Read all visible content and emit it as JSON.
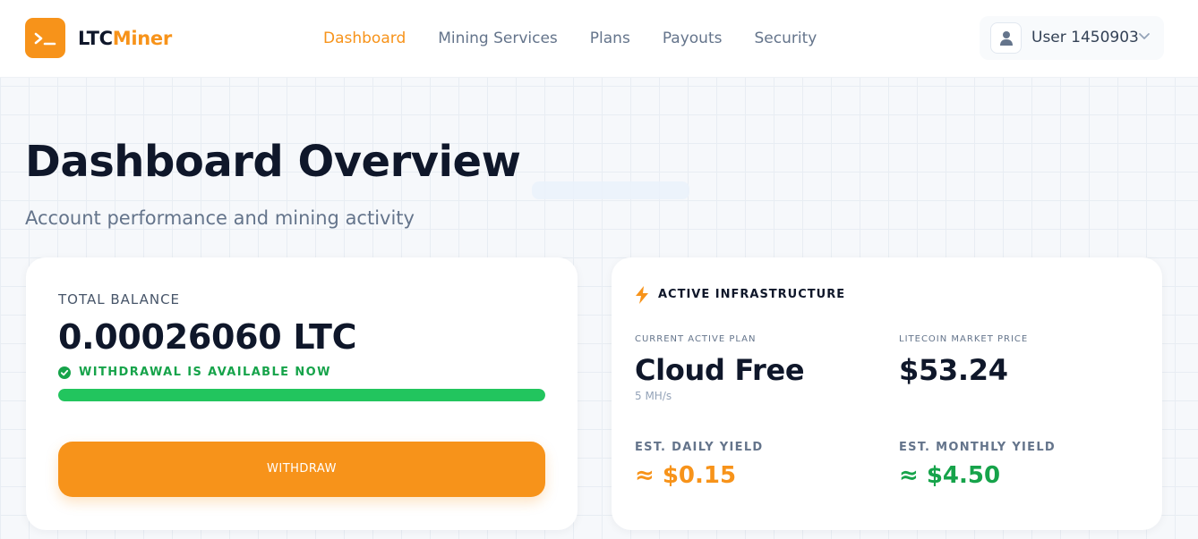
{
  "header": {
    "brand_part1": "LTC",
    "brand_part2": "Miner",
    "logo_icon": "terminal-prompt-icon",
    "nav": [
      {
        "label": "Dashboard",
        "active": true
      },
      {
        "label": "Mining Services",
        "active": false
      },
      {
        "label": "Plans",
        "active": false
      },
      {
        "label": "Payouts",
        "active": false
      },
      {
        "label": "Security",
        "active": false
      }
    ],
    "user": {
      "name": "User 1450903",
      "avatar_icon": "user-icon",
      "menu_icon": "chevron-down-icon"
    }
  },
  "page": {
    "title": "Dashboard Overview",
    "subtitle": "Account performance and mining activity"
  },
  "balance_card": {
    "label": "TOTAL BALANCE",
    "value": "0.00026060 LTC",
    "status_text": "WITHDRAWAL IS AVAILABLE NOW",
    "status_icon": "check-circle-icon",
    "progress_percent": 100,
    "withdraw_label": "WITHDRAW"
  },
  "infra_card": {
    "title": "ACTIVE INFRASTRUCTURE",
    "title_icon": "lightning-bolt-icon",
    "plan_label": "CURRENT ACTIVE PLAN",
    "plan_value": "Cloud Free",
    "plan_hashrate": "5 MH/s",
    "price_label": "LITECOIN MARKET PRICE",
    "price_value": "$53.24",
    "daily_label": "EST. DAILY YIELD",
    "daily_value": "≈ $0.15",
    "monthly_label": "EST. MONTHLY YIELD",
    "monthly_value": "≈ $4.50"
  },
  "colors": {
    "accent": "#f7931a",
    "success": "#16a34a",
    "success_bar": "#22c55e",
    "text_dark": "#0f172a",
    "text_muted": "#64748b"
  }
}
